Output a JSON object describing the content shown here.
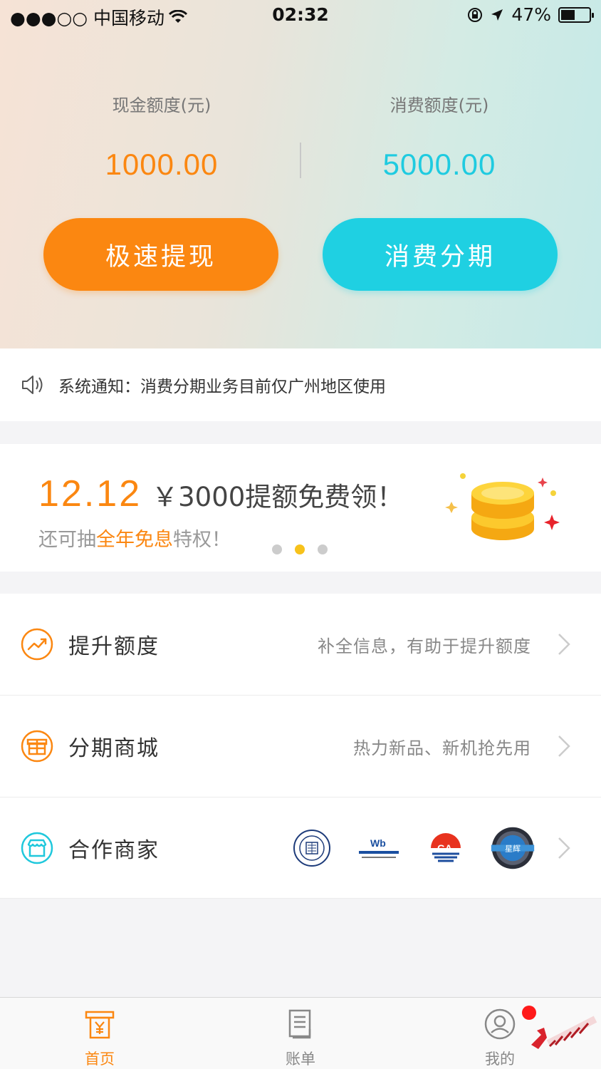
{
  "status_bar": {
    "carrier": "●●●○○ 中国移动",
    "time": "02:32",
    "battery": "47%",
    "battery_level": 0.47
  },
  "quota": {
    "cash_label": "现金额度(元)",
    "cash_value": "1000.00",
    "consume_label": "消费额度(元)",
    "consume_value": "5000.00"
  },
  "actions": {
    "withdraw_label": "极速提现",
    "installment_label": "消费分期"
  },
  "notice": {
    "text": "系统通知：消费分期业务目前仅广州地区使用"
  },
  "banner": {
    "date": "12.12",
    "headline": "￥3000提额免费领！",
    "sub_prefix": "还可抽",
    "sub_highlight": "全年免息",
    "sub_suffix": "特权！",
    "dots_total": 3,
    "dots_active": 1
  },
  "menu": [
    {
      "title": "提升额度",
      "hint": "补全信息，有助于提升额度"
    },
    {
      "title": "分期商城",
      "hint": "热力新品、新机抢先用"
    },
    {
      "title": "合作商家",
      "hint": ""
    }
  ],
  "partners": {
    "p2_text": "Wb",
    "p3_text": "GA",
    "p4_text": "星辉"
  },
  "tabbar": {
    "home": "首页",
    "bill": "账单",
    "mine": "我的"
  },
  "colors": {
    "orange": "#fb8711",
    "cyan": "#1fd0e2",
    "badge": "#ff1a1a"
  }
}
